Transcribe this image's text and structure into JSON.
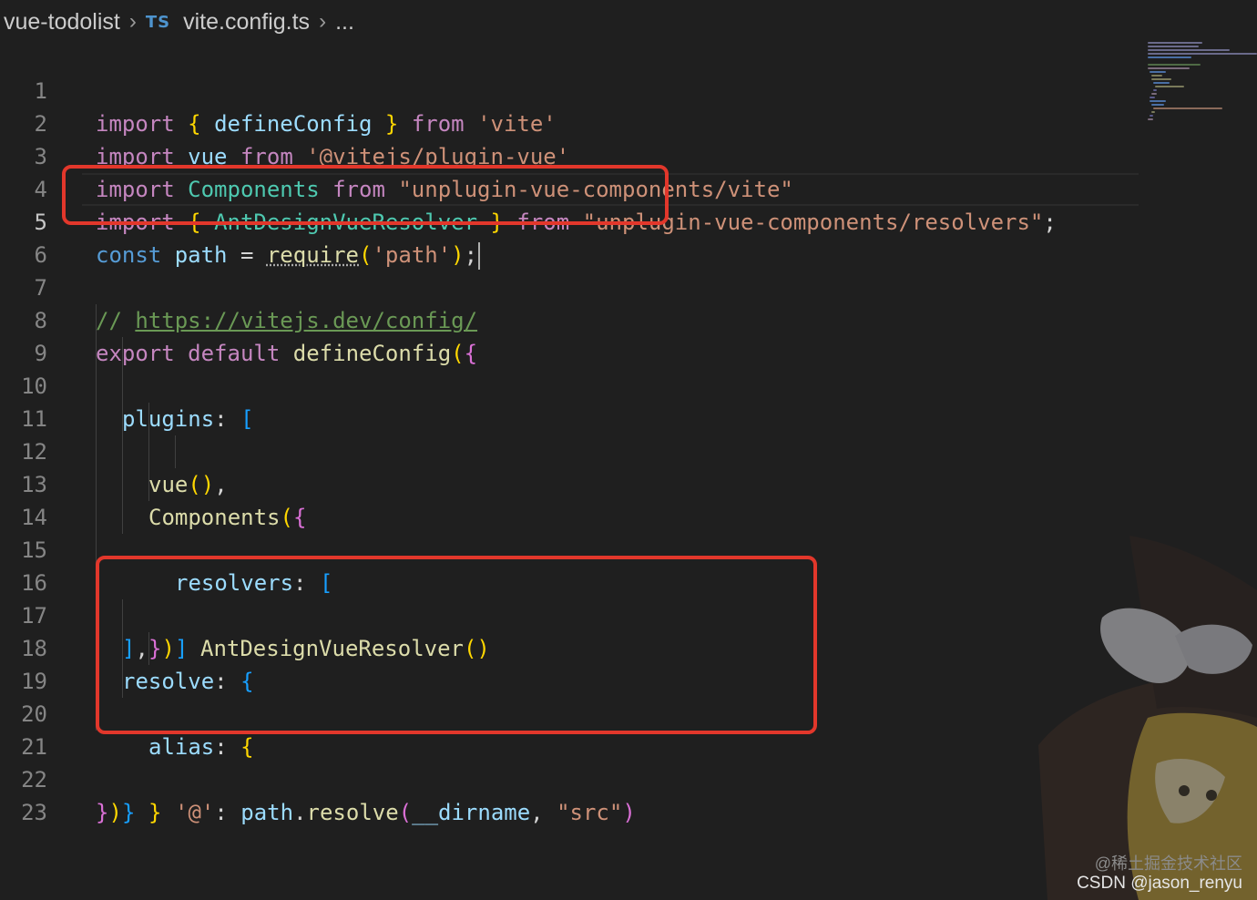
{
  "breadcrumb": {
    "folder": "vue-todolist",
    "file_badge": "TS",
    "file": "vite.config.ts",
    "more": "..."
  },
  "editor": {
    "line_numbers": [
      "1",
      "2",
      "3",
      "4",
      "5",
      "6",
      "7",
      "8",
      "9",
      "10",
      "11",
      "12",
      "13",
      "14",
      "15",
      "16",
      "17",
      "18",
      "19",
      "20",
      "21",
      "22",
      "23"
    ],
    "current_line": 5
  },
  "code": {
    "l1": [
      "import",
      "{",
      "defineConfig",
      "}",
      "from",
      "'vite'"
    ],
    "l2": [
      "import",
      "vue",
      "from",
      "'@vitejs/plugin-vue'"
    ],
    "l3": [
      "import",
      "Components",
      "from",
      "\"unplugin-vue-components/vite\""
    ],
    "l4": [
      "import",
      "{",
      "AntDesignVueResolver",
      "}",
      "from",
      "\"unplugin-vue-components/resolvers\"",
      ";"
    ],
    "l5": [
      "const",
      "path",
      "=",
      "require",
      "(",
      "'path'",
      ")",
      ";"
    ],
    "l7": [
      "//",
      "https://vitejs.dev/config/"
    ],
    "l8": [
      "export",
      "default",
      "defineConfig",
      "(",
      "{"
    ],
    "l9": [
      "plugins",
      ":",
      "["
    ],
    "l10": [
      "vue",
      "()",
      ","
    ],
    "l11": [
      "Components",
      "(",
      "{"
    ],
    "l12": [
      "resolvers",
      ":",
      "["
    ],
    "l13": [
      "AntDesignVueResolver",
      "()"
    ],
    "l14": [
      "]"
    ],
    "l15": [
      "}",
      ")"
    ],
    "l16": [
      "]",
      ","
    ],
    "l17": [
      "resolve",
      ":",
      "{"
    ],
    "l18": [
      "alias",
      ":",
      "{"
    ],
    "l19": [
      "'@'",
      ":",
      "path",
      ".",
      "resolve",
      "(",
      "__dirname",
      ",",
      "\"src\"",
      ")"
    ],
    "l20": [
      "}"
    ],
    "l21": [
      "}"
    ],
    "l22": [
      "}",
      ")"
    ]
  },
  "watermark": {
    "line1": "@稀土掘金技术社区",
    "line2": "CSDN @jason_renyu"
  },
  "colors": {
    "background": "#1f1f1f",
    "keyword_import": "#c586c0",
    "keyword_storage": "#569cd6",
    "variable": "#9cdcfe",
    "class": "#4ec9b0",
    "function": "#dcdcaa",
    "string": "#ce9178",
    "comment": "#6a9955",
    "bracket_1": "#ffd700",
    "bracket_2": "#da70d6",
    "bracket_3": "#179fff",
    "annotation_box": "#e2372b"
  },
  "icons": {
    "breadcrumb_separator": "chevron-right-icon",
    "file_type": "typescript-icon"
  }
}
